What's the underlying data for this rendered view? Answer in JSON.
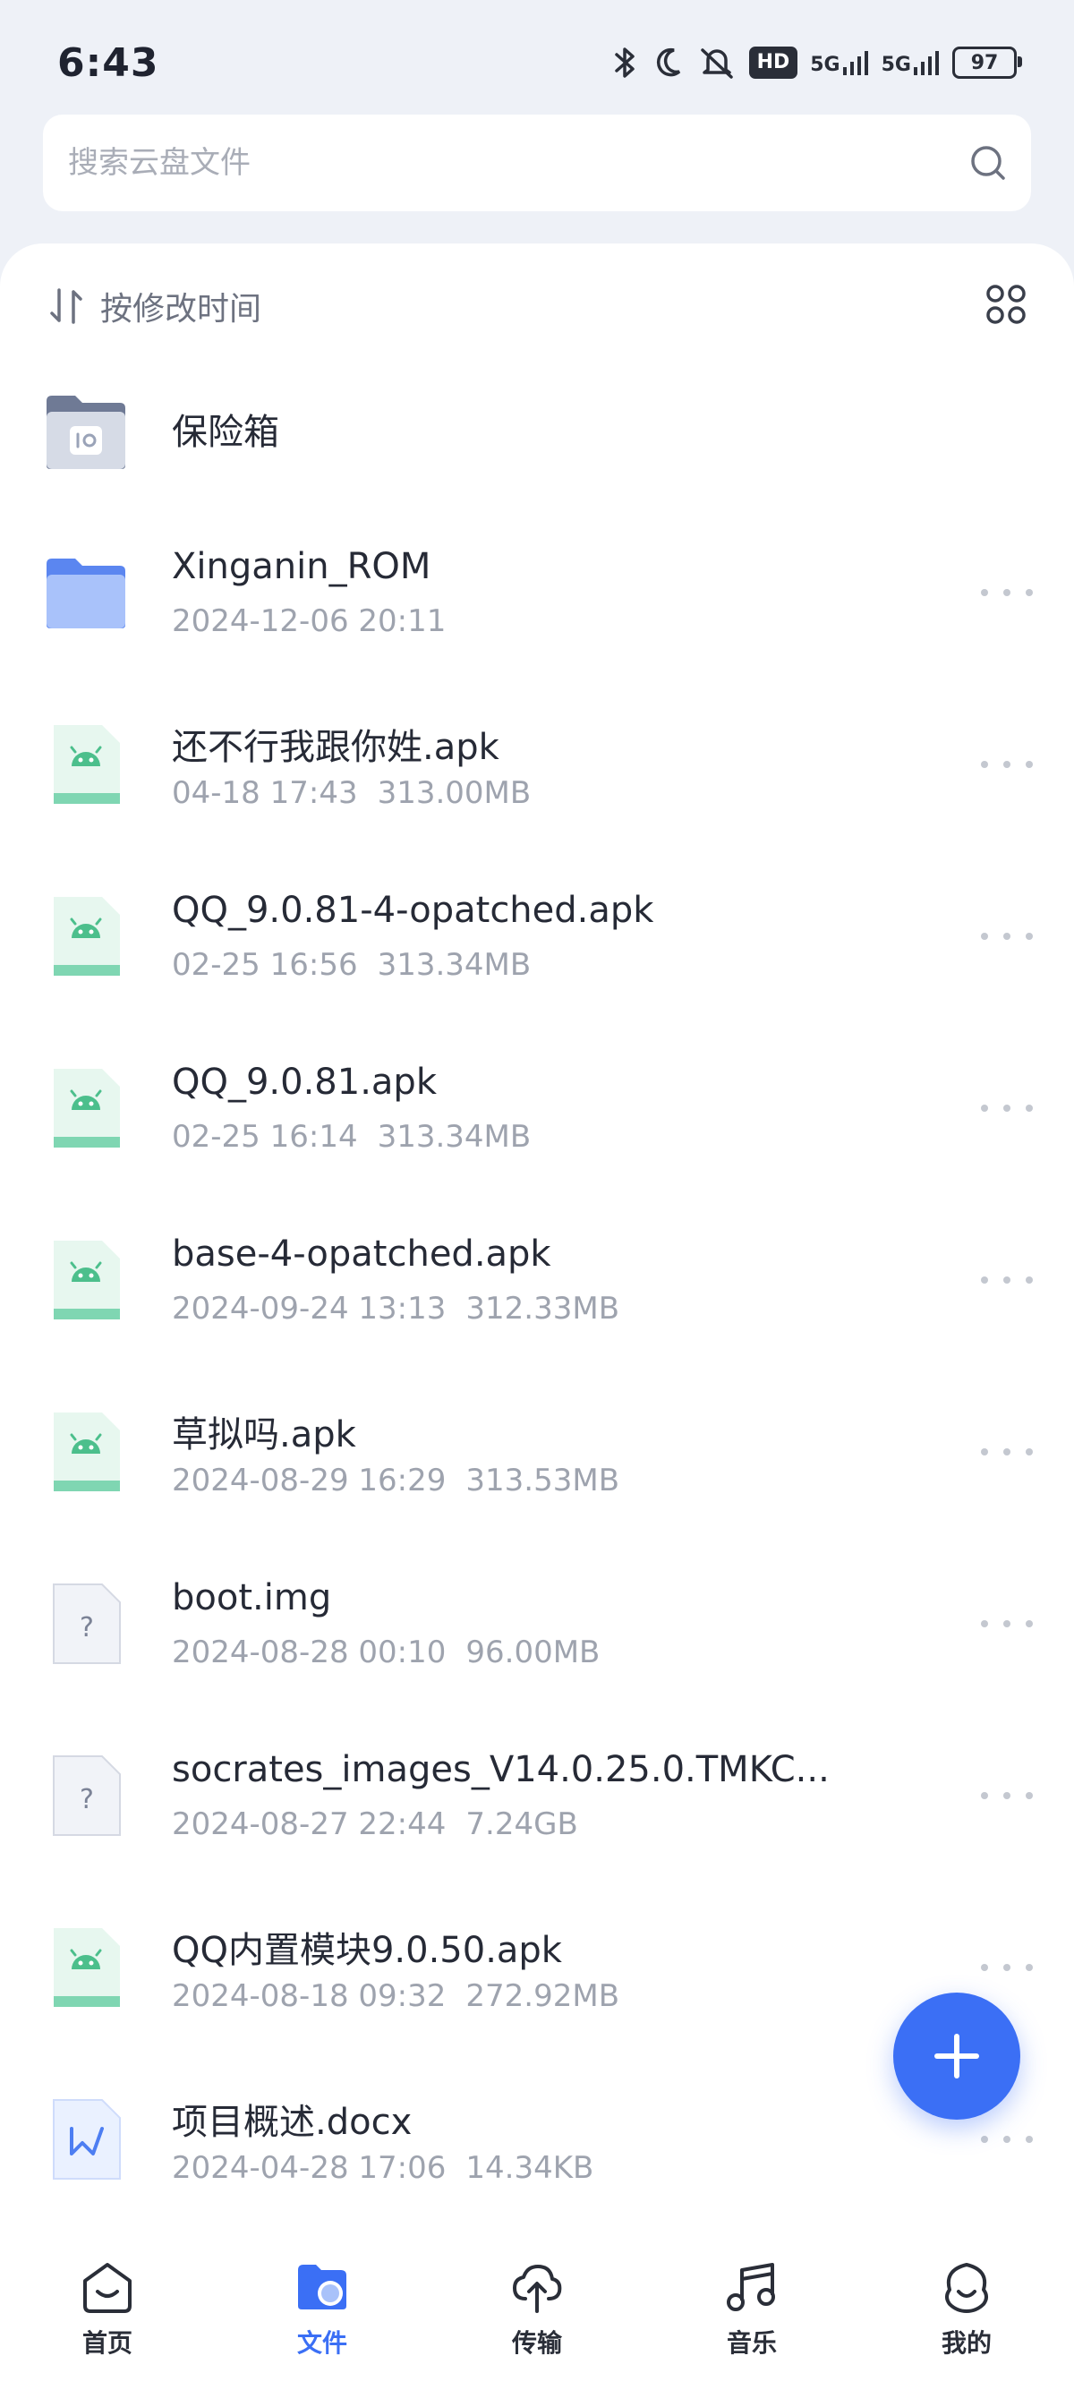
{
  "status": {
    "time": "6:43",
    "hd_badge": "HD",
    "signal1": "5G",
    "signal2": "5G",
    "battery": "97"
  },
  "search": {
    "placeholder": "搜索云盘文件"
  },
  "sort": {
    "label": "按修改时间"
  },
  "vault": {
    "name": "保险箱"
  },
  "files": [
    {
      "name": "Xinganin_ROM",
      "date": "2024-12-06 20:11",
      "size": "",
      "type": "folder"
    },
    {
      "name": "还不行我跟你姓.apk",
      "date": "04-18 17:43",
      "size": "313.00MB",
      "type": "apk"
    },
    {
      "name": "QQ_9.0.81-4-opatched.apk",
      "date": "02-25 16:56",
      "size": "313.34MB",
      "type": "apk"
    },
    {
      "name": "QQ_9.0.81.apk",
      "date": "02-25 16:14",
      "size": "313.34MB",
      "type": "apk"
    },
    {
      "name": "base-4-opatched.apk",
      "date": "2024-09-24 13:13",
      "size": "312.33MB",
      "type": "apk"
    },
    {
      "name": "草拟吗.apk",
      "date": "2024-08-29 16:29",
      "size": "313.53MB",
      "type": "apk"
    },
    {
      "name": "boot.img",
      "date": "2024-08-28 00:10",
      "size": "96.00MB",
      "type": "unknown"
    },
    {
      "name": "socrates_images_V14.0.25.0.TMKC...",
      "date": "2024-08-27 22:44",
      "size": "7.24GB",
      "type": "unknown"
    },
    {
      "name": "QQ内置模块9.0.50.apk",
      "date": "2024-08-18 09:32",
      "size": "272.92MB",
      "type": "apk"
    },
    {
      "name": "项目概述.docx",
      "date": "2024-04-28 17:06",
      "size": "14.34KB",
      "type": "docx"
    }
  ],
  "tabs": [
    {
      "label": "首页",
      "icon": "home-icon",
      "active": false
    },
    {
      "label": "文件",
      "icon": "folder-icon",
      "active": true
    },
    {
      "label": "传输",
      "icon": "cloud-transfer-icon",
      "active": false
    },
    {
      "label": "音乐",
      "icon": "music-icon",
      "active": false
    },
    {
      "label": "我的",
      "icon": "profile-icon",
      "active": false
    }
  ],
  "colors": {
    "accent": "#3b6ff5",
    "apk_green": "#5fcaa0",
    "folder_blue": "#8fb0f7",
    "background": "#eef1f7"
  }
}
